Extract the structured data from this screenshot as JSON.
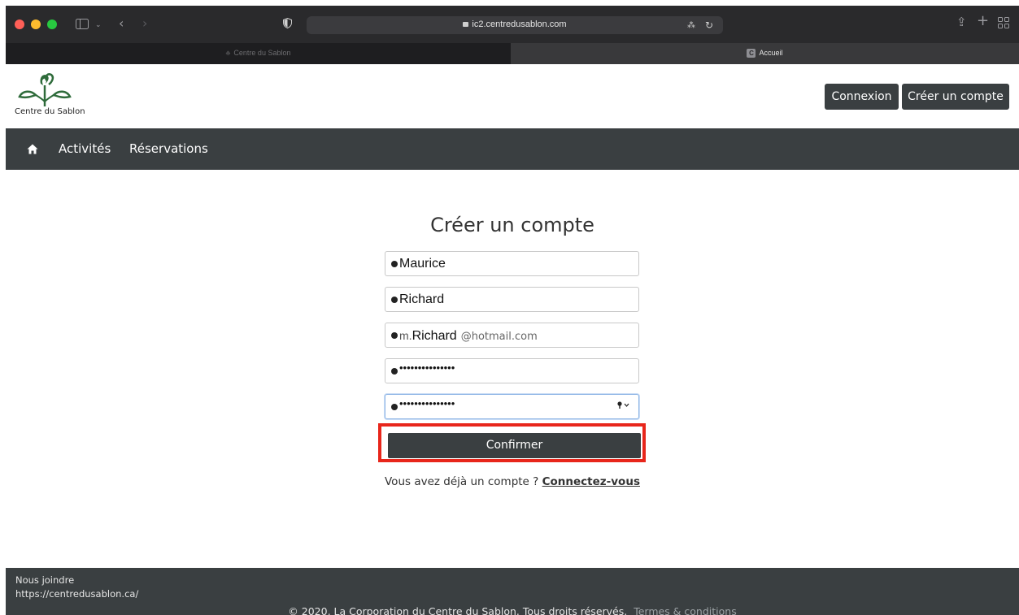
{
  "browser": {
    "url": "ic2.centredusablon.com",
    "tabs": [
      {
        "label": "Centre du Sablon",
        "badge": ""
      },
      {
        "label": "Accueil",
        "badge": "C"
      }
    ]
  },
  "header": {
    "logo_text": "Centre du Sablon",
    "login_label": "Connexion",
    "signup_label": "Créer un compte"
  },
  "nav": {
    "home_icon": "home-icon",
    "items": [
      "Activités",
      "Réservations"
    ]
  },
  "form": {
    "title": "Créer un compte",
    "first_name": "Maurice",
    "last_name": "Richard",
    "email_user": "m.",
    "email_name": "Richard",
    "email_domain": "@hotmail.com",
    "password_mask": "•••••••••••••••",
    "password_confirm_mask": "•••••••••••••••",
    "confirm_label": "Confirmer",
    "has_account_text": "Vous avez déjà un compte ?",
    "login_link": "Connectez-vous"
  },
  "footer": {
    "contact_title": "Nous joindre",
    "contact_url": "https://centredusablon.ca/",
    "copyright": "© 2020, La Corporation du Centre du Sablon. Tous droits réservés.",
    "terms": "Termes & conditions"
  },
  "colors": {
    "highlight": "#e8261b",
    "dark": "#3a3f41",
    "logo_green": "#2e6b3a"
  }
}
